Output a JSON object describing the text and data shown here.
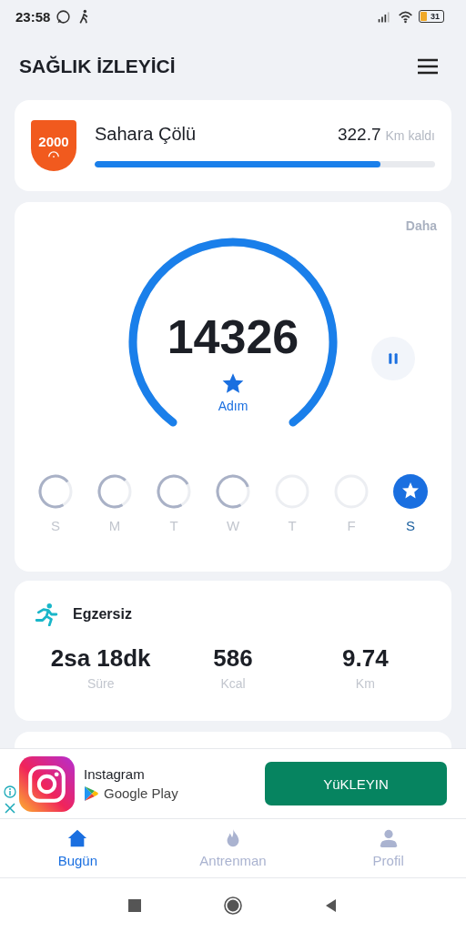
{
  "status_bar": {
    "time": "23:58",
    "battery": "31"
  },
  "header": {
    "title": "SAĞLIK İZLEYİCİ"
  },
  "challenge": {
    "badge": "2000",
    "name": "Sahara Çölü",
    "remaining": "322.7",
    "unit": "Km kaldı",
    "level": 0.84
  },
  "steps": {
    "more": "Daha",
    "count": "14326",
    "label": "Adım",
    "paused": false,
    "days": [
      {
        "label": "S",
        "done": false,
        "selected": false
      },
      {
        "label": "M",
        "done": false,
        "selected": false
      },
      {
        "label": "T",
        "done": false,
        "selected": false
      },
      {
        "label": "W",
        "done": false,
        "selected": false
      },
      {
        "label": "T",
        "done": false,
        "selected": false
      },
      {
        "label": "F",
        "done": false,
        "selected": false
      },
      {
        "label": "S",
        "done": true,
        "selected": true
      }
    ]
  },
  "exercise": {
    "title": "Egzersiz",
    "stats": [
      {
        "value": "2sa 18dk",
        "label": "Süre"
      },
      {
        "value": "586",
        "label": "Kcal"
      },
      {
        "value": "9.74",
        "label": "Km"
      }
    ]
  },
  "ad": {
    "app": "Instagram",
    "store": "Google Play",
    "button": "YüKLEYIN"
  },
  "tabs": [
    {
      "label": "Bugün",
      "kind": "home",
      "selected": true
    },
    {
      "label": "Antrenman",
      "kind": "flame",
      "selected": false
    },
    {
      "label": "Profil",
      "kind": "person",
      "selected": false
    }
  ]
}
